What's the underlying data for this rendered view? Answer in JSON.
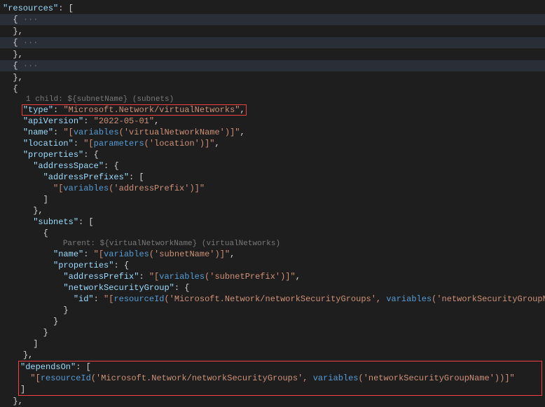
{
  "code": {
    "resources_key": "\"resources\"",
    "open_bracket": ": [",
    "fold_open": "{ ",
    "fold_dots": "···",
    "fold_close_comma": "},",
    "brace_open": "{",
    "brace_close": "}",
    "brace_close_comma": "},",
    "bracket_open": "[",
    "bracket_close": "]",
    "bracket_close_comma": "],",
    "colon_space": ": ",
    "comma": ",",
    "codelens1": "1 child: ${subnetName} (subnets)",
    "codelens2": "Parent: ${virtualNetworkName} (virtualNetworks)",
    "type_key": "\"type\"",
    "type_val": "\"Microsoft.Network/virtualNetworks\"",
    "apiVersion_key": "\"apiVersion\"",
    "apiVersion_val": "\"2022-05-01\"",
    "name_key": "\"name\"",
    "name_val_open": "\"[",
    "variables_fn": "variables",
    "vnetName_arg": "('virtualNetworkName')",
    "name_val_close": "]\"",
    "location_key": "\"location\"",
    "parameters_fn": "parameters",
    "location_arg": "('location')",
    "properties_key": "\"properties\"",
    "addressSpace_key": "\"addressSpace\"",
    "addressPrefixes_key": "\"addressPrefixes\"",
    "addressPrefix_arg": "('addressPrefix')",
    "subnets_key": "\"subnets\"",
    "subnetName_arg": "('subnetName')",
    "addressPrefix_key": "\"addressPrefix\"",
    "subnetPrefix_arg": "('subnetPrefix')",
    "nsg_key": "\"networkSecurityGroup\"",
    "id_key": "\"id\"",
    "resourceId_fn": "resourceId",
    "nsg_type_arg": "('Microsoft.Network/networkSecurityGroups', ",
    "nsgName_arg": "('networkSecurityGroupName')",
    "close_paren_bracket": ")]\"",
    "dependsOn_key": "\"dependsOn\""
  }
}
